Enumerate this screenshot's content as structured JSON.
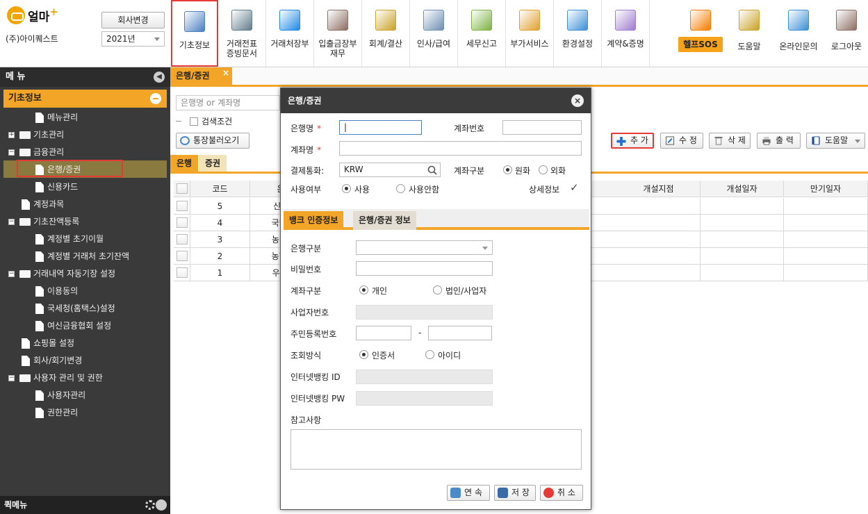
{
  "header": {
    "logo_text": "얼마",
    "logo_plus": "+",
    "company_name": "(주)아이퀘스트",
    "change_company_label": "회사변경",
    "year_selected": "2021년"
  },
  "toolbar": [
    {
      "label": "기초정보",
      "icon": "basic-info-icon",
      "color": "#4a7fc1"
    },
    {
      "label": "거래전표\n증빙문서",
      "icon": "voucher-icon",
      "color": "#607d8b"
    },
    {
      "label": "거래처장부",
      "icon": "ledger-icon",
      "color": "#1e88e5"
    },
    {
      "label": "입출금장부\n재무",
      "icon": "money-bag-icon",
      "color": "#8d6e63"
    },
    {
      "label": "회계/결산",
      "icon": "accounting-icon",
      "color": "#c9a227"
    },
    {
      "label": "인사/급여",
      "icon": "hr-icon",
      "color": "#6d8fb3"
    },
    {
      "label": "세무신고",
      "icon": "tax-icon",
      "color": "#7cb342"
    },
    {
      "label": "부가서비스",
      "icon": "bank-building-icon",
      "color": "#e0a030"
    },
    {
      "label": "환경설정",
      "icon": "settings-gear-icon",
      "color": "#3b8fd6"
    },
    {
      "label": "계약&증명",
      "icon": "contract-pen-icon",
      "color": "#9e7bd0"
    }
  ],
  "toolbar_right": [
    {
      "label": "헬프SOS",
      "icon": "sos-icon",
      "color": "#f57c00"
    },
    {
      "label": "도움말",
      "icon": "help-book-icon",
      "color": "#c9a227"
    },
    {
      "label": "온라인문의",
      "icon": "online-inquiry-icon",
      "color": "#3b8fd6"
    },
    {
      "label": "로그아웃",
      "icon": "logout-door-icon",
      "color": "#8d6e63"
    }
  ],
  "sidebar": {
    "title": "메 뉴",
    "section": "기초정보",
    "items": [
      {
        "label": "메뉴관리",
        "level": 1,
        "type": "doc"
      },
      {
        "label": "기초관리",
        "level": 0,
        "type": "folder",
        "expander": "+"
      },
      {
        "label": "금융관리",
        "level": 0,
        "type": "folder",
        "expander": "-"
      },
      {
        "label": "은행/증권",
        "level": 1,
        "type": "doc",
        "selected": true
      },
      {
        "label": "신용카드",
        "level": 1,
        "type": "doc"
      },
      {
        "label": "계정과목",
        "level": 0,
        "type": "doc"
      },
      {
        "label": "기초잔액등록",
        "level": 0,
        "type": "folder",
        "expander": "-"
      },
      {
        "label": "계정별 초기이월",
        "level": 1,
        "type": "doc"
      },
      {
        "label": "계정별 거래처 초기잔액",
        "level": 1,
        "type": "doc"
      },
      {
        "label": "거래내역 자동기장 설정",
        "level": 0,
        "type": "folder",
        "expander": "-"
      },
      {
        "label": "이용동의",
        "level": 1,
        "type": "doc"
      },
      {
        "label": "국세청(홈택스)설정",
        "level": 1,
        "type": "doc"
      },
      {
        "label": "여신금융협회 설정",
        "level": 1,
        "type": "doc"
      },
      {
        "label": "쇼핑몰 설정",
        "level": 0,
        "type": "doc"
      },
      {
        "label": "회사/회기변경",
        "level": 0,
        "type": "doc"
      },
      {
        "label": "사용자 관리 및 권한",
        "level": 0,
        "type": "folder",
        "expander": "-"
      },
      {
        "label": "사용자관리",
        "level": 1,
        "type": "doc"
      },
      {
        "label": "권한관리",
        "level": 1,
        "type": "doc"
      }
    ],
    "footer": "퀵메뉴"
  },
  "content": {
    "tab_title": "은행/증권",
    "tab_close": "×",
    "search_placeholder": "은행명 or 계좌명",
    "search_condition": "검색조건",
    "passbook_button": "통장불러오기",
    "actions": {
      "add": "추 가",
      "edit": "수 정",
      "delete": "삭 제",
      "print": "출 력",
      "help": "도움말"
    },
    "subtabs": [
      "은행",
      "증권"
    ],
    "grid": {
      "columns": [
        "코드",
        "은행",
        "개설지점",
        "개설일자",
        "만기일자"
      ],
      "rows": [
        {
          "code": "5",
          "bank": "신한은"
        },
        {
          "code": "4",
          "bank": "국민(제"
        },
        {
          "code": "3",
          "bank": "농협.주"
        },
        {
          "code": "2",
          "bank": "농협(기"
        },
        {
          "code": "1",
          "bank": "우리-D"
        }
      ]
    }
  },
  "dialog": {
    "title": "은행/증권",
    "close": "×",
    "fields": {
      "bank_name_label": "은행명",
      "bank_name_value": "|",
      "account_no_label": "계좌번호",
      "account_name_label": "계좌명",
      "currency_label": "결제통화:",
      "currency_value": "KRW",
      "account_type_label": "계좌구분",
      "account_type_options": [
        "원화",
        "외화"
      ],
      "usage_label": "사용여부",
      "usage_options": [
        "사용",
        "사용안함"
      ],
      "detail_label": "상세정보",
      "detail_checked": "✓"
    },
    "tabs": [
      "뱅크 인증정보",
      "은행/증권 정보"
    ],
    "cert": {
      "bank_type_label": "은행구분",
      "password_label": "비밀번호",
      "account_kind_label": "계좌구분",
      "account_kind_options": [
        "개인",
        "법인/사업자"
      ],
      "biz_no_label": "사업자번호",
      "resident_no_label": "주민등록번호",
      "resident_sep": "-",
      "query_method_label": "조회방식",
      "query_method_options": [
        "인증서",
        "아이디"
      ],
      "ib_id_label": "인터넷뱅킹 ID",
      "ib_pw_label": "인터넷뱅킹 PW",
      "note_label": "참고사항"
    },
    "buttons": {
      "continue": "연 속",
      "save": "저 장",
      "cancel": "취 소"
    }
  }
}
